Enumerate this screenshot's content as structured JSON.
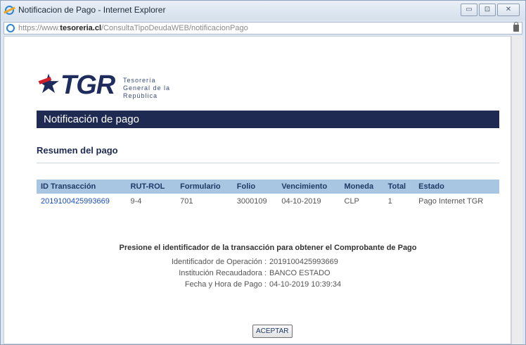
{
  "window": {
    "title": "Notificacion de Pago - Internet Explorer",
    "buttons": {
      "minimize": "▭",
      "maximize": "⊡",
      "close": "✕"
    }
  },
  "address": {
    "scheme": "https://www.",
    "domain": "tesoreria.cl",
    "path": "/ConsultaTipoDeudaWEB/notificacionPago"
  },
  "logo": {
    "mark": "TGR",
    "line1": "Tesorería",
    "line2": "General de la",
    "line3": "República"
  },
  "banner": {
    "title": "Notificación de pago"
  },
  "summary": {
    "title": "Resumen del pago"
  },
  "table": {
    "headers": [
      "ID Transacción",
      "RUT-ROL",
      "Formulario",
      "Folio",
      "Vencimiento",
      "Moneda",
      "Total",
      "Estado"
    ],
    "rows": [
      [
        "2019100425993669",
        "9-4",
        "701",
        "3000109",
        "04-10-2019",
        "CLP",
        "1",
        "Pago Internet TGR"
      ]
    ]
  },
  "info": {
    "heading": "Presione el identificador de la transacción para obtener el Comprobante de Pago",
    "rows": [
      {
        "label": "Identificador de Operación :",
        "value": "2019100425993669"
      },
      {
        "label": "Institución Recaudadora :",
        "value": "BANCO ESTADO"
      },
      {
        "label": "Fecha y Hora de Pago :",
        "value": "04-10-2019 10:39:34"
      }
    ]
  },
  "actions": {
    "accept": "ACEPTAR"
  },
  "colors": {
    "banner": "#1e2a52",
    "table_header": "#a8c6e2",
    "link": "#1a4fb7",
    "logo_red": "#d31f2b"
  }
}
